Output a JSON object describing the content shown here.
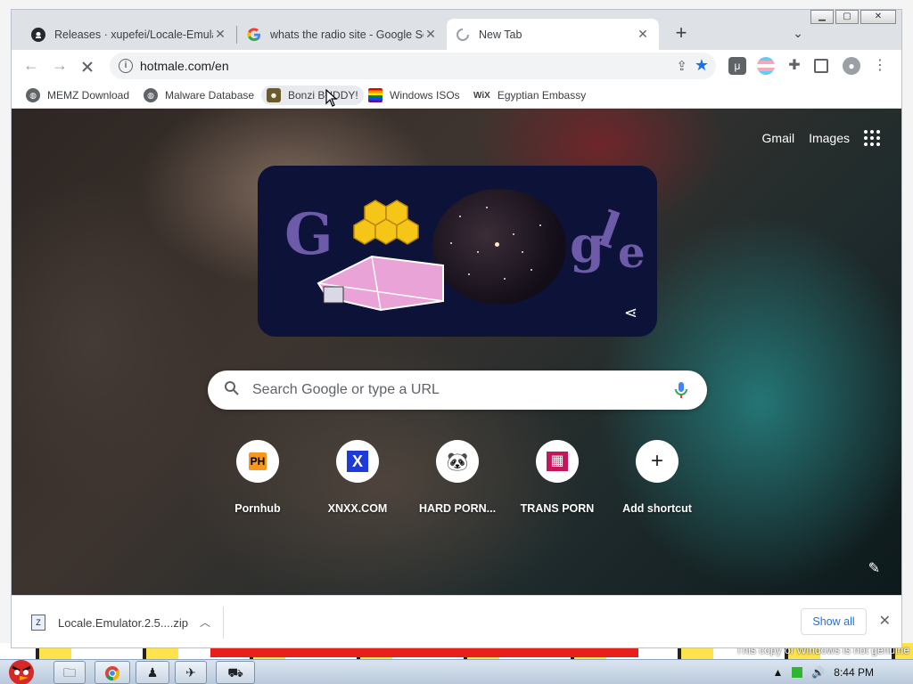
{
  "tabs": [
    {
      "title": "Releases · xupefei/Locale-Emulat",
      "icon": "github-icon",
      "active": false
    },
    {
      "title": "whats the radio site - Google Sea",
      "icon": "google-icon",
      "active": false
    },
    {
      "title": "New Tab",
      "icon": "loading-spinner-icon",
      "active": true
    }
  ],
  "address": {
    "url": "hotmale.com/en"
  },
  "bookmarks": [
    {
      "label": "MEMZ Download",
      "icon": "globe-icon"
    },
    {
      "label": "Malware Database",
      "icon": "globe-icon"
    },
    {
      "label": "Bonzi BUDDY!",
      "icon": "bonzi-icon"
    },
    {
      "label": "Windows ISOs",
      "icon": "windows-flag-icon"
    },
    {
      "label": "Egyptian Embassy",
      "icon": "wix-icon",
      "prefix": "WiX"
    }
  ],
  "ntp": {
    "gmail": "Gmail",
    "images": "Images",
    "search_placeholder": "Search Google or type a URL",
    "shortcuts": [
      {
        "label": "Pornhub",
        "glyph": "PH",
        "color": "#f7971d"
      },
      {
        "label": "XNXX.COM",
        "glyph": "X",
        "color": "#1d3bd6"
      },
      {
        "label": "HARD PORN...",
        "glyph": "🐼",
        "color": "#000000"
      },
      {
        "label": "TRANS PORN",
        "glyph": "▦",
        "color": "#c2185b"
      },
      {
        "label": "Add shortcut",
        "glyph": "+",
        "color": "#202124"
      }
    ]
  },
  "download": {
    "filename": "Locale.Emulator.2.5....zip",
    "show_all": "Show all"
  },
  "desktop": {
    "genuine_notice": "This copy of Windows is not genuine"
  },
  "taskbar": {
    "clock": "8:44 PM"
  },
  "colors": {
    "accent": "#1a73e8",
    "titlebar": "#dee1e6"
  }
}
